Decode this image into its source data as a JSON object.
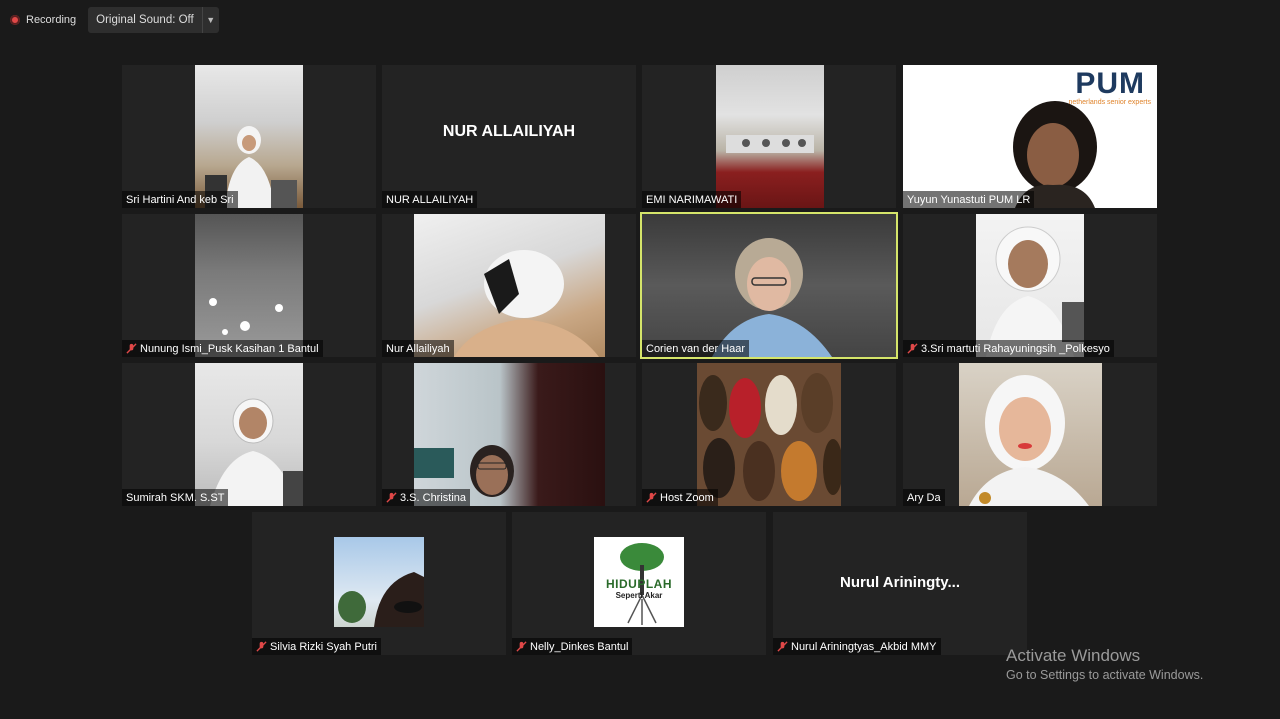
{
  "topbar": {
    "recording_label": "Recording",
    "sound_label": "Original Sound: Off"
  },
  "tiles": [
    {
      "name": "Sri Hartini And keb Sri",
      "muted": false
    },
    {
      "name": "NUR ALLAILIYAH",
      "display_name": "NUR ALLAILIYAH",
      "muted": false
    },
    {
      "name": "EMI NARIMAWATI",
      "muted": false
    },
    {
      "name": "Yuyun Yunastuti PUM LR",
      "muted": false,
      "logo": "PUM",
      "logo_sub": "netherlands senior experts"
    },
    {
      "name": "Nunung Ismi_Pusk Kasihan 1 Bantul",
      "muted": true
    },
    {
      "name": "Nur Allailiyah",
      "muted": false
    },
    {
      "name": "Corien van der Haar",
      "muted": false,
      "active_speaker": true
    },
    {
      "name": "3.Sri martuti Rahayuningsih _Polkesyo",
      "muted": true
    },
    {
      "name": "Sumirah SKM. S.ST",
      "muted": false
    },
    {
      "name": "3.S. Christina",
      "muted": true
    },
    {
      "name": "Host Zoom",
      "muted": true
    },
    {
      "name": "Ary Da",
      "muted": false
    },
    {
      "name": "Silvia Rizki Syah Putri",
      "muted": true
    },
    {
      "name": "Nelly_Dinkes Bantul",
      "muted": true,
      "avatar_title": "HIDUPLAH",
      "avatar_sub": "Seperti Akar"
    },
    {
      "name": "Nurul Ariningtyas_Akbid MMY",
      "display_name": "Nurul  Ariningty...",
      "muted": true
    }
  ],
  "watermark": {
    "title": "Activate Windows",
    "subtitle": "Go to Settings to activate Windows."
  },
  "colors": {
    "active_border": "#d5e56a",
    "muted_icon": "#e04848",
    "background": "#1a1a1a",
    "tile_bg": "#232323"
  }
}
